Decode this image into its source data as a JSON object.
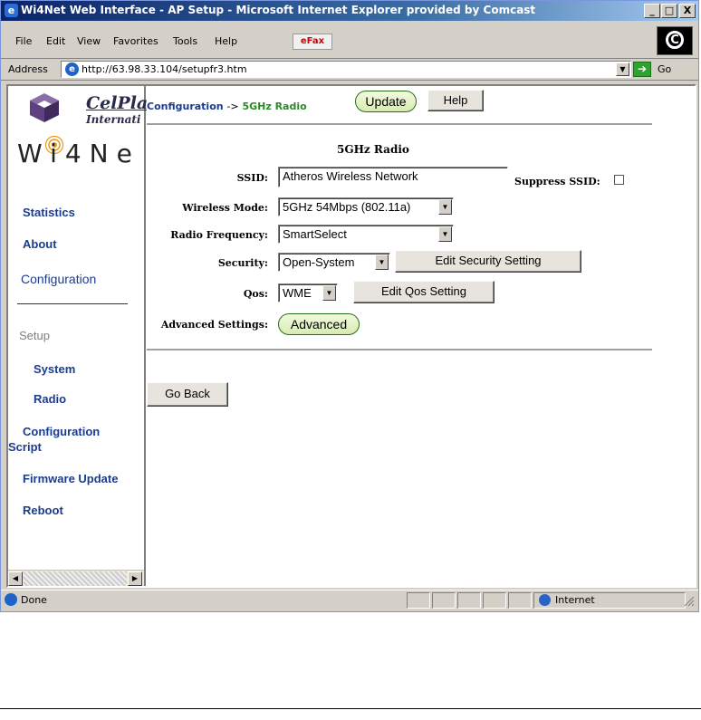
{
  "window": {
    "title": "Wi4Net Web Interface - AP Setup - Microsoft Internet Explorer provided by Comcast",
    "controls": {
      "minimize": "_",
      "maximize": "□",
      "close": "X"
    }
  },
  "menu": {
    "items": [
      "File",
      "Edit",
      "View",
      "Favorites",
      "Tools",
      "Help"
    ],
    "efax": "eFax"
  },
  "address": {
    "label": "Address",
    "url": "http://63.98.33.104/setupfr3.htm",
    "go": "Go"
  },
  "left_nav": {
    "logo_text": "CelPla",
    "logo_sub": "Internati",
    "product": "Wi4Ne",
    "items": {
      "statistics": "Statistics",
      "about": "About",
      "configuration": "Configuration",
      "setup": "Setup",
      "system": "System",
      "radio": "Radio",
      "config_script_1": "Configuration",
      "config_script_2": "Script",
      "firmware": "Firmware Update",
      "reboot": "Reboot"
    }
  },
  "main": {
    "breadcrumb": {
      "config": "Configuration",
      "arrow": "->",
      "current": "5GHz Radio"
    },
    "update_button": "Update",
    "help_button": "Help",
    "section_title": "5GHz Radio",
    "ssid": {
      "label": "SSID:",
      "value": "Atheros Wireless Network"
    },
    "suppress_ssid": {
      "label": "Suppress SSID:",
      "checked": false
    },
    "wireless_mode": {
      "label": "Wireless Mode:",
      "value": "5GHz 54Mbps (802.11a)"
    },
    "radio_frequency": {
      "label": "Radio Frequency:",
      "value": "SmartSelect"
    },
    "security": {
      "label": "Security:",
      "value": "Open-System",
      "edit_button": "Edit Security Setting"
    },
    "qos": {
      "label": "Qos:",
      "value": "WME",
      "edit_button": "Edit Qos Setting"
    },
    "advanced": {
      "label": "Advanced Settings:",
      "button": "Advanced"
    },
    "go_back": "Go Back"
  },
  "status": {
    "text": "Done",
    "zone": "Internet"
  }
}
